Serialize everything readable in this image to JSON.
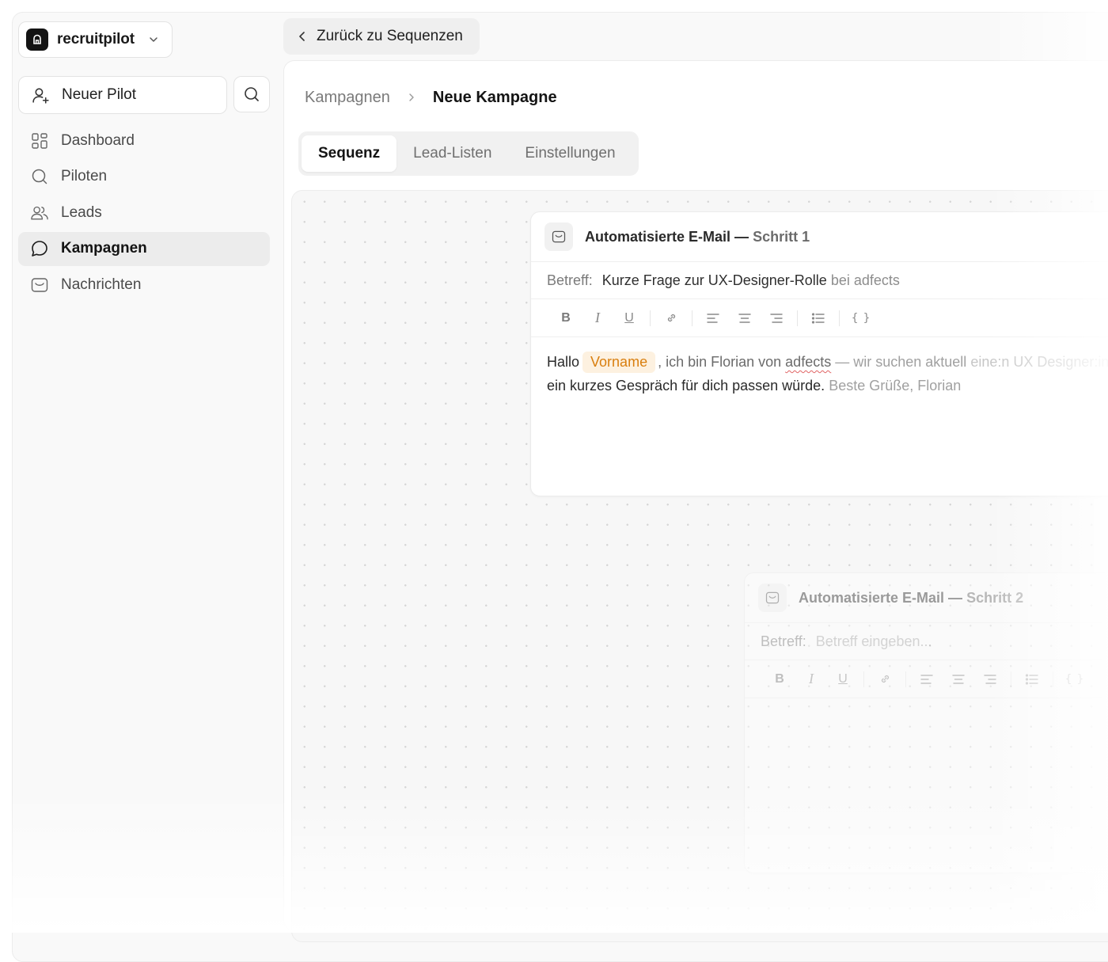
{
  "workspace": {
    "name": "recruitpilot"
  },
  "sidebar": {
    "new_pilot_label": "Neuer Pilot",
    "items": [
      {
        "label": "Dashboard",
        "icon": "dashboard-icon"
      },
      {
        "label": "Piloten",
        "icon": "search-icon"
      },
      {
        "label": "Leads",
        "icon": "users-icon"
      },
      {
        "label": "Kampagnen",
        "icon": "chat-bubble-icon",
        "active": true
      },
      {
        "label": "Nachrichten",
        "icon": "inbox-icon"
      }
    ]
  },
  "header": {
    "back_label": "Zurück zu Sequenzen",
    "breadcrumb": [
      "Kampagnen",
      "Neue Kampagne"
    ]
  },
  "tabs": [
    {
      "label": "Sequenz",
      "active": true
    },
    {
      "label": "Lead-Listen"
    },
    {
      "label": "Einstellungen"
    }
  ],
  "steps": [
    {
      "title_main": "Automatisierte E-Mail —",
      "title_step": "Schritt 1",
      "subject_label": "Betreff:",
      "subject_main": "Kurze Frage zur UX-Designer-Rolle",
      "subject_tail": "bei adfects",
      "body": {
        "greeting": "Hallo",
        "variable": "Vorname",
        "part1": ", ich bin Florian von",
        "company": "adfects",
        "part2": "— wir suchen aktuell",
        "part3": "eine:n UX Designer:in",
        "line2_main": "ein kurzes Gespräch für dich passen würde.",
        "line2_tail": "Beste Grüße, Florian"
      }
    },
    {
      "title_main": "Automatisierte E-Mail —",
      "title_step": "Schritt 2",
      "subject_label": "Betreff:",
      "subject_placeholder": "Betreff eingeben..."
    }
  ],
  "accent_color": "#d97f0f"
}
